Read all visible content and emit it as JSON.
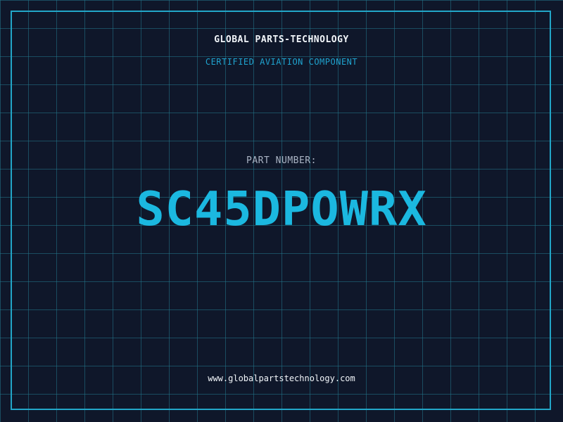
{
  "header": {
    "company": "GLOBAL PARTS-TECHNOLOGY",
    "subtitle": "CERTIFIED AVIATION COMPONENT"
  },
  "main": {
    "part_label": "PART NUMBER:",
    "part_number": "SC45DPOWRX"
  },
  "footer": {
    "website": "www.globalpartstechnology.com"
  },
  "colors": {
    "background": "#0f172a",
    "grid": "#22788c",
    "accent": "#1bb8e0",
    "border": "#22a6c8",
    "text": "#f1f5f9",
    "muted": "#aab4c4"
  }
}
